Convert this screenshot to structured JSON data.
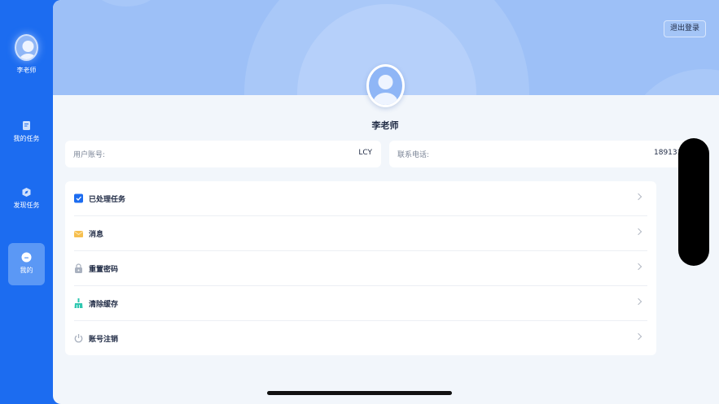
{
  "sidebar": {
    "user_name": "李老师",
    "items": [
      {
        "label": "我的任务",
        "icon": "document-icon"
      },
      {
        "label": "发现任务",
        "icon": "compass-icon"
      },
      {
        "label": "我的",
        "icon": "user-icon"
      }
    ],
    "active_index": 2
  },
  "header": {
    "logout_label": "退出登录"
  },
  "profile": {
    "name": "李老师",
    "account_label": "用户账号:",
    "account_value": "LCY",
    "phone_label": "联系电话:",
    "phone_value": "1891314"
  },
  "menu": [
    {
      "label": "已处理任务",
      "icon": "checkbox-icon"
    },
    {
      "label": "消息",
      "icon": "envelope-icon"
    },
    {
      "label": "重置密码",
      "icon": "lock-icon"
    },
    {
      "label": "清除缓存",
      "icon": "broom-icon"
    },
    {
      "label": "账号注销",
      "icon": "power-icon"
    }
  ],
  "colors": {
    "primary": "#1c6cf0",
    "banner": "#9dc0f7",
    "background": "#f2f6fb",
    "text": "#1f2a44"
  }
}
